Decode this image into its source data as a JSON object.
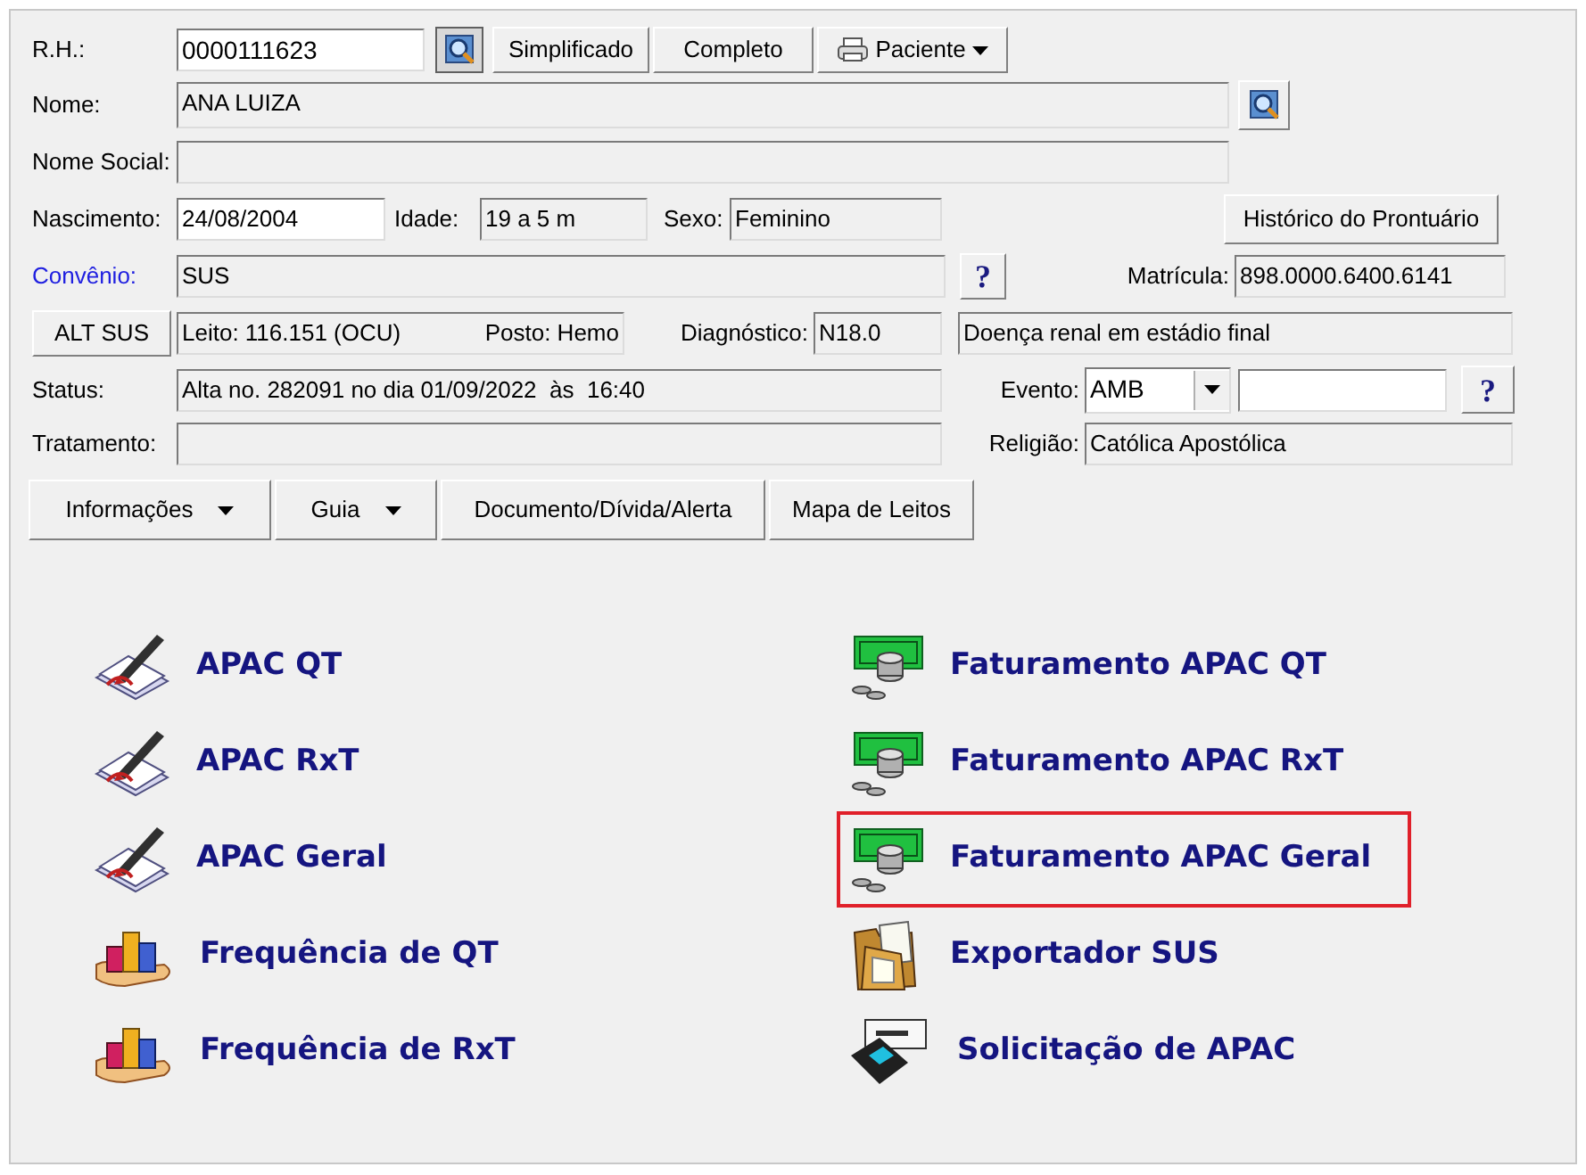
{
  "rh": {
    "label": "R.H.:",
    "value": "0000111623"
  },
  "simplificado_button": "Simplificado",
  "completo_button": "Completo",
  "paciente_button": "Paciente",
  "nome": {
    "label": "Nome:",
    "value": "ANA LUIZA"
  },
  "nome_social": {
    "label": "Nome Social:"
  },
  "nascimento": {
    "label": "Nascimento:",
    "value": "24/08/2004"
  },
  "idade": {
    "label": "Idade:",
    "value": "19 a 5 m"
  },
  "sexo": {
    "label": "Sexo:",
    "value": "Feminino"
  },
  "historico_button": "Histórico do Prontuário",
  "convenio": {
    "label": "Convênio:",
    "value": "SUS",
    "help": "?"
  },
  "matricula": {
    "label": "Matrícula:",
    "value": "898.0000.6400.6141"
  },
  "alt_sus_button": "ALT SUS",
  "leito": "Leito: 116.151 (OCU)",
  "posto": "Posto: Hemo",
  "diagnostico": {
    "label": "Diagnóstico:",
    "code": "N18.0",
    "description": "Doença renal em estádio final"
  },
  "status": {
    "label": "Status:",
    "value": "Alta no. 282091 no dia 01/09/2022  às  16:40"
  },
  "evento": {
    "label": "Evento:",
    "value": "AMB",
    "help": "?"
  },
  "tratamento": {
    "label": "Tratamento:"
  },
  "religiao": {
    "label": "Religião:",
    "value": "Católica Apostólica"
  },
  "action_buttons": [
    {
      "label": "Informações",
      "dropdown": true
    },
    {
      "label": "Guia",
      "dropdown": true
    },
    {
      "label": "Documento/Dívida/Alerta",
      "dropdown": false
    },
    {
      "label": "Mapa de Leitos",
      "dropdown": false
    }
  ],
  "left_modules": [
    {
      "label": "APAC QT",
      "kind": "pen",
      "highlighted": false
    },
    {
      "label": "APAC RxT",
      "kind": "pen",
      "highlighted": false
    },
    {
      "label": "APAC Geral",
      "kind": "pen",
      "highlighted": false
    },
    {
      "label": "Frequência de QT",
      "kind": "chart",
      "highlighted": false
    },
    {
      "label": "Frequência de RxT",
      "kind": "chart",
      "highlighted": false
    }
  ],
  "right_modules": [
    {
      "label": "Faturamento APAC QT",
      "kind": "money",
      "highlighted": false
    },
    {
      "label": "Faturamento APAC RxT",
      "kind": "money",
      "highlighted": false
    },
    {
      "label": "Faturamento APAC Geral",
      "kind": "money",
      "highlighted": true
    },
    {
      "label": "Exportador SUS",
      "kind": "folder",
      "highlighted": false
    },
    {
      "label": "Solicitação de APAC",
      "kind": "terminal",
      "highlighted": false
    }
  ]
}
